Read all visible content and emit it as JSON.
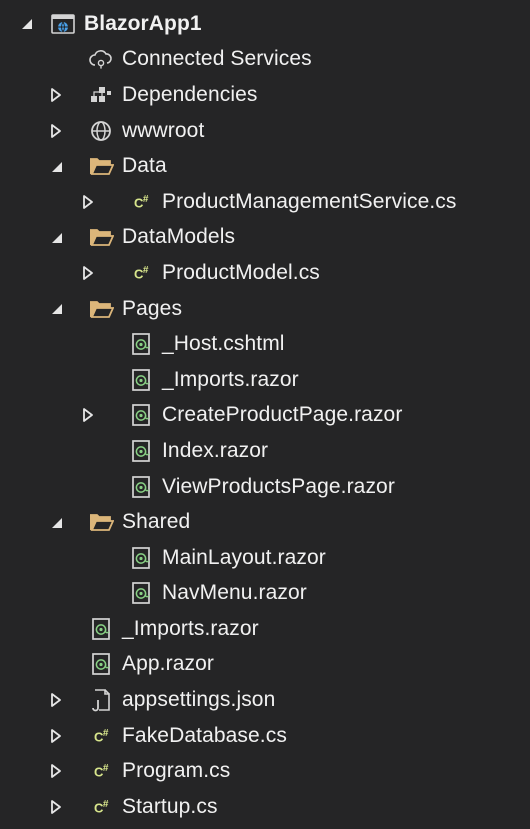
{
  "tree": [
    {
      "label": "BlazorApp1",
      "icon": "web-project-icon",
      "toggle": "expanded",
      "depth": 0,
      "bold": true
    },
    {
      "label": "Connected Services",
      "icon": "connected-services-icon",
      "toggle": "none",
      "depth": 1
    },
    {
      "label": "Dependencies",
      "icon": "dependencies-icon",
      "toggle": "collapsed",
      "depth": 1
    },
    {
      "label": "wwwroot",
      "icon": "globe-icon",
      "toggle": "collapsed",
      "depth": 1
    },
    {
      "label": "Data",
      "icon": "folder-open-icon",
      "toggle": "expanded",
      "depth": 1
    },
    {
      "label": "ProductManagementService.cs",
      "icon": "csharp-file-icon",
      "toggle": "collapsed",
      "depth": 2
    },
    {
      "label": "DataModels",
      "icon": "folder-open-icon",
      "toggle": "expanded",
      "depth": 1
    },
    {
      "label": "ProductModel.cs",
      "icon": "csharp-file-icon",
      "toggle": "collapsed",
      "depth": 2
    },
    {
      "label": "Pages",
      "icon": "folder-open-icon",
      "toggle": "expanded",
      "depth": 1
    },
    {
      "label": "_Host.cshtml",
      "icon": "razor-file-icon",
      "toggle": "none",
      "depth": 2
    },
    {
      "label": "_Imports.razor",
      "icon": "razor-file-icon",
      "toggle": "none",
      "depth": 2
    },
    {
      "label": "CreateProductPage.razor",
      "icon": "razor-file-icon",
      "toggle": "collapsed",
      "depth": 2
    },
    {
      "label": "Index.razor",
      "icon": "razor-file-icon",
      "toggle": "none",
      "depth": 2
    },
    {
      "label": "ViewProductsPage.razor",
      "icon": "razor-file-icon",
      "toggle": "none",
      "depth": 2
    },
    {
      "label": "Shared",
      "icon": "folder-open-icon",
      "toggle": "expanded",
      "depth": 1
    },
    {
      "label": "MainLayout.razor",
      "icon": "razor-file-icon",
      "toggle": "none",
      "depth": 2
    },
    {
      "label": "NavMenu.razor",
      "icon": "razor-file-icon",
      "toggle": "none",
      "depth": 2
    },
    {
      "label": "_Imports.razor",
      "icon": "razor-file-icon",
      "toggle": "none",
      "depth": 1
    },
    {
      "label": "App.razor",
      "icon": "razor-file-icon",
      "toggle": "none",
      "depth": 1
    },
    {
      "label": "appsettings.json",
      "icon": "json-file-icon",
      "toggle": "collapsed",
      "depth": 1
    },
    {
      "label": "FakeDatabase.cs",
      "icon": "csharp-file-icon",
      "toggle": "collapsed",
      "depth": 1
    },
    {
      "label": "Program.cs",
      "icon": "csharp-file-icon",
      "toggle": "collapsed",
      "depth": 1
    },
    {
      "label": "Startup.cs",
      "icon": "csharp-file-icon",
      "toggle": "collapsed",
      "depth": 1
    }
  ],
  "colors": {
    "background": "#252526",
    "text": "#f1f1f1",
    "folder": "#dcb67a",
    "csharp": "#d8e68c",
    "razor_border": "#d4d4d4",
    "razor_mark": "#89d185",
    "project_blue": "#4aa0e8"
  }
}
